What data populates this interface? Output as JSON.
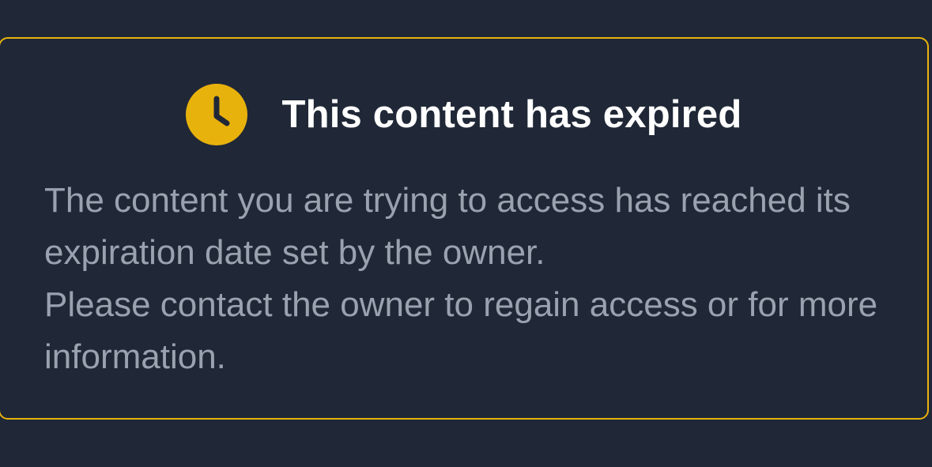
{
  "notice": {
    "title": "This content has expired",
    "message_line_1": "The content you are trying to access has reached its expiration date set by the owner.",
    "message_line_2": "Please contact the owner to regain access or for more information.",
    "icon": "clock-icon"
  },
  "colors": {
    "background": "#202837",
    "accent": "#e8b20c",
    "title_text": "#ffffff",
    "body_text": "#9aa2b0"
  }
}
